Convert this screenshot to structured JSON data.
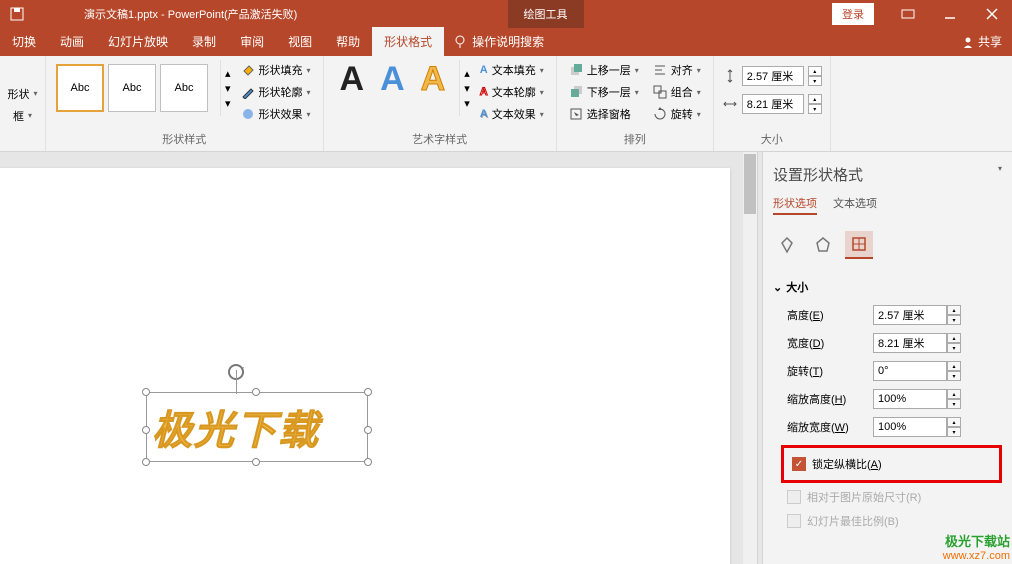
{
  "title": {
    "filename": "演示文稿1.pptx",
    "app": "PowerPoint(产品激活失败)",
    "contextual": "绘图工具",
    "login": "登录"
  },
  "tabs": {
    "t0": "切换",
    "t1": "动画",
    "t2": "幻灯片放映",
    "t3": "录制",
    "t4": "审阅",
    "t5": "视图",
    "t6": "帮助",
    "t7": "形状格式",
    "search": "操作说明搜索",
    "share": "共享"
  },
  "ribbon": {
    "insert_shape": {
      "shape_label": "形状",
      "frame_label": "框",
      "abc": "Abc"
    },
    "group1": {
      "fill": "形状填充",
      "outline": "形状轮廓",
      "effects": "形状效果",
      "label": "形状样式"
    },
    "group2": {
      "textfill": "文本填充",
      "textoutline": "文本轮廓",
      "texteffects": "文本效果",
      "label": "艺术字样式"
    },
    "group3": {
      "forward": "上移一层",
      "backward": "下移一层",
      "selection": "选择窗格",
      "align": "对齐",
      "group": "组合",
      "rotate": "旋转",
      "label": "排列"
    },
    "group4": {
      "height": "2.57 厘米",
      "width": "8.21 厘米",
      "label": "大小"
    }
  },
  "canvas": {
    "wordart": "极光下载"
  },
  "pane": {
    "title": "设置形状格式",
    "tab_shape": "形状选项",
    "tab_text": "文本选项",
    "section_size": "大小",
    "height_label": "高度(E)",
    "height_val": "2.57 厘米",
    "width_label": "宽度(D)",
    "width_val": "8.21 厘米",
    "rotate_label": "旋转(T)",
    "rotate_val": "0°",
    "scale_h_label": "缩放高度(H)",
    "scale_h_val": "100%",
    "scale_w_label": "缩放宽度(W)",
    "scale_w_val": "100%",
    "lock_aspect": "锁定纵横比(A)",
    "relative_orig": "相对于图片原始尺寸(R)",
    "slide_best": "幻灯片最佳比例(B)"
  },
  "watermark": {
    "name": "极光下载站",
    "url": "www.xz7.com"
  }
}
